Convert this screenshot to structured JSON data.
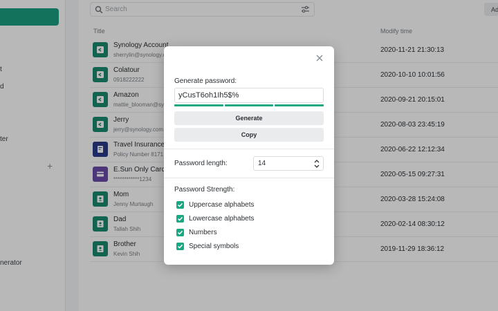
{
  "sidebar": {
    "fragments": [
      "t",
      "d",
      "ter",
      "nerator"
    ],
    "plus": "+"
  },
  "search": {
    "placeholder": "Search"
  },
  "toolbar": {
    "add_label": "Ad"
  },
  "table": {
    "columns": {
      "title": "Title",
      "modify_time": "Modify time"
    },
    "rows": [
      {
        "title": "Synology Account",
        "subtitle": "sherrylin@synology.c",
        "time": "2020-11-21 21:30:13",
        "icon": "login-icon",
        "color": "#1a8a6f"
      },
      {
        "title": "Colatour",
        "subtitle": "0918222222",
        "time": "2020-10-10 10:01:56",
        "icon": "login-icon",
        "color": "#1a8a6f"
      },
      {
        "title": "Amazon",
        "subtitle": "mattie_blooman@sy",
        "time": "2020-09-21 20:15:01",
        "icon": "login-icon",
        "color": "#1a8a6f"
      },
      {
        "title": "Jerry",
        "subtitle": "jerry@synology.com",
        "time": "2020-08-03 23:45:19",
        "icon": "login-icon",
        "color": "#1a8a6f"
      },
      {
        "title": "Travel Insurance",
        "subtitle": "Policy Number 8171",
        "time": "2020-06-22 12:12:34",
        "icon": "document-icon",
        "color": "#2b3a8a"
      },
      {
        "title": "E.Sun Only Card",
        "subtitle": "************1234",
        "time": "2020-05-15 09:27:31",
        "icon": "card-icon",
        "color": "#6b4aa8"
      },
      {
        "title": "Mom",
        "subtitle": "Jenny Murtaugh",
        "time": "2020-03-28 15:24:08",
        "icon": "contact-icon",
        "color": "#1a8a6f"
      },
      {
        "title": "Dad",
        "subtitle": "Tallah Shih",
        "time": "2020-02-14 08:30:12",
        "icon": "contact-icon",
        "color": "#1a8a6f"
      },
      {
        "title": "Brother",
        "subtitle": "Kevin Shih",
        "time": "2019-11-29 18:36:12",
        "icon": "contact-icon",
        "color": "#1a8a6f"
      }
    ]
  },
  "modal": {
    "generate_label": "Generate password:",
    "password": "yCusT6oh1Ih5$%",
    "strength_segments": 3,
    "generate_button": "Generate",
    "copy_button": "Copy",
    "length_label": "Password length:",
    "length_value": "14",
    "strength_label": "Password Strength:",
    "options": [
      {
        "label": "Uppercase alphabets",
        "checked": true
      },
      {
        "label": "Lowercase alphabets",
        "checked": true
      },
      {
        "label": "Numbers",
        "checked": true
      },
      {
        "label": "Special symbols",
        "checked": true
      }
    ]
  },
  "colors": {
    "accent": "#1aa883",
    "primary_button": "#1a9e7e"
  }
}
